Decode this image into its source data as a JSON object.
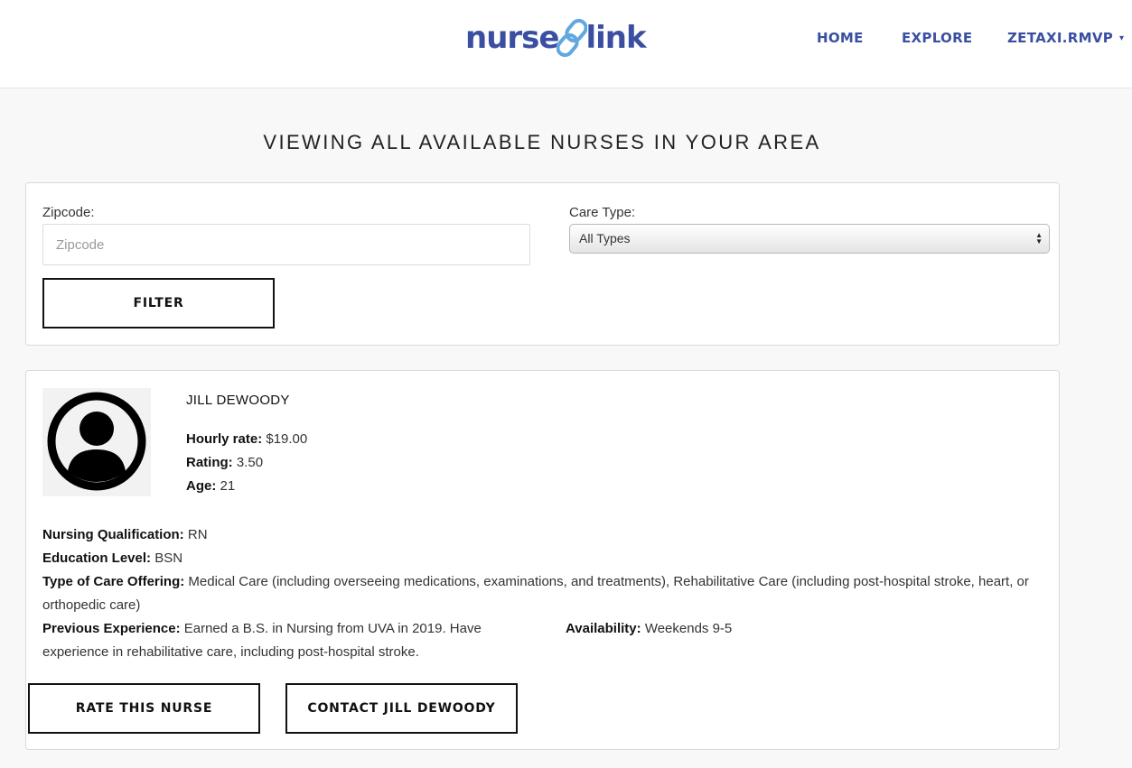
{
  "nav": {
    "logo_left": "nurse",
    "logo_right": "link",
    "home": "HOME",
    "explore": "EXPLORE",
    "user": "ZETAXI.RMVP",
    "user_caret": "▾"
  },
  "page": {
    "title": "VIEWING ALL AVAILABLE NURSES IN YOUR AREA"
  },
  "filter": {
    "zip_label": "Zipcode:",
    "zip_placeholder": "Zipcode",
    "zip_value": "",
    "care_label": "Care Type:",
    "care_selected": "All Types",
    "filter_button": "FILTER"
  },
  "nurse": {
    "name": "JILL DEWOODY",
    "hourly_rate_label": "Hourly rate:",
    "hourly_rate_value": "$19.00",
    "rating_label": "Rating:",
    "rating_value": "3.50",
    "age_label": "Age:",
    "age_value": "21",
    "qualification_label": "Nursing Qualification:",
    "qualification_value": "RN",
    "education_label": "Education Level:",
    "education_value": "BSN",
    "care_type_label": "Type of Care Offering:",
    "care_type_value": "Medical Care (including overseeing medications, examinations, and treatments), Rehabilitative Care (including post-hospital stroke, heart, or orthopedic care)",
    "experience_label": "Previous Experience:",
    "experience_value": "Earned a B.S. in Nursing from UVA in 2019. Have experience in rehabilitative care, including post-hospital stroke.",
    "availability_label": "Availability:",
    "availability_value": "Weekends 9-5",
    "rate_button": "RATE THIS NURSE",
    "contact_button": "CONTACT JILL DEWOODY"
  },
  "colors": {
    "brand": "#3b4fa2",
    "logo_link_accent": "#5fa8e0",
    "page_background": "#f8f8f8"
  }
}
